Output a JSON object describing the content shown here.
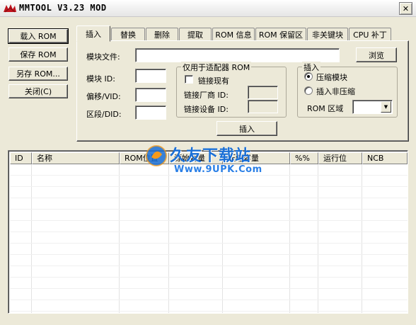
{
  "window": {
    "title": "MMTOOL V3.23 MOD",
    "close_glyph": "✕"
  },
  "left_buttons": {
    "load_rom": "载入 ROM",
    "save_rom": "保存 ROM",
    "save_as_rom": "另存 ROM...",
    "close": "关闭(C)"
  },
  "tabs": [
    {
      "label": "插入",
      "active": true
    },
    {
      "label": "替换"
    },
    {
      "label": "删除"
    },
    {
      "label": "提取"
    },
    {
      "label": "ROM 信息"
    },
    {
      "label": "ROM 保留区"
    },
    {
      "label": "非关键块"
    },
    {
      "label": "CPU 补丁"
    }
  ],
  "insert_panel": {
    "module_file_label": "模块文件:",
    "module_file_value": "",
    "browse_label": "浏览",
    "module_id_label": "模块 ID:",
    "module_id_value": "",
    "offset_vid_label": "偏移/VID:",
    "offset_vid_value": "",
    "segment_did_label": "区段/DID:",
    "segment_did_value": "",
    "adapter_group_title": "仅用于适配器 ROM",
    "link_existing_label": "链接现有",
    "link_existing_checked": false,
    "vendor_id_label": "链接厂商 ID:",
    "vendor_id_value": "",
    "device_id_label": "链接设备 ID:",
    "device_id_value": "",
    "insert_group_title": "插入",
    "compressed_label": "压缩模块",
    "uncompressed_label": "插入非压缩",
    "selected_mode": "compressed",
    "rom_region_label": "ROM 区域",
    "rom_region_value": "",
    "insert_button_label": "插入"
  },
  "list": {
    "columns": [
      "ID",
      "名称",
      "ROM位置",
      "源始容量",
      "压缩容量",
      "%%",
      "运行位",
      "NCB"
    ]
  },
  "watermark": {
    "brand": "久友下载站",
    "url": "Www.9UPK.Com"
  },
  "colors": {
    "window_bg": "#ece9d8",
    "watermark_blue": "#1a6fd6",
    "watermark_orange": "#f59a1a"
  }
}
